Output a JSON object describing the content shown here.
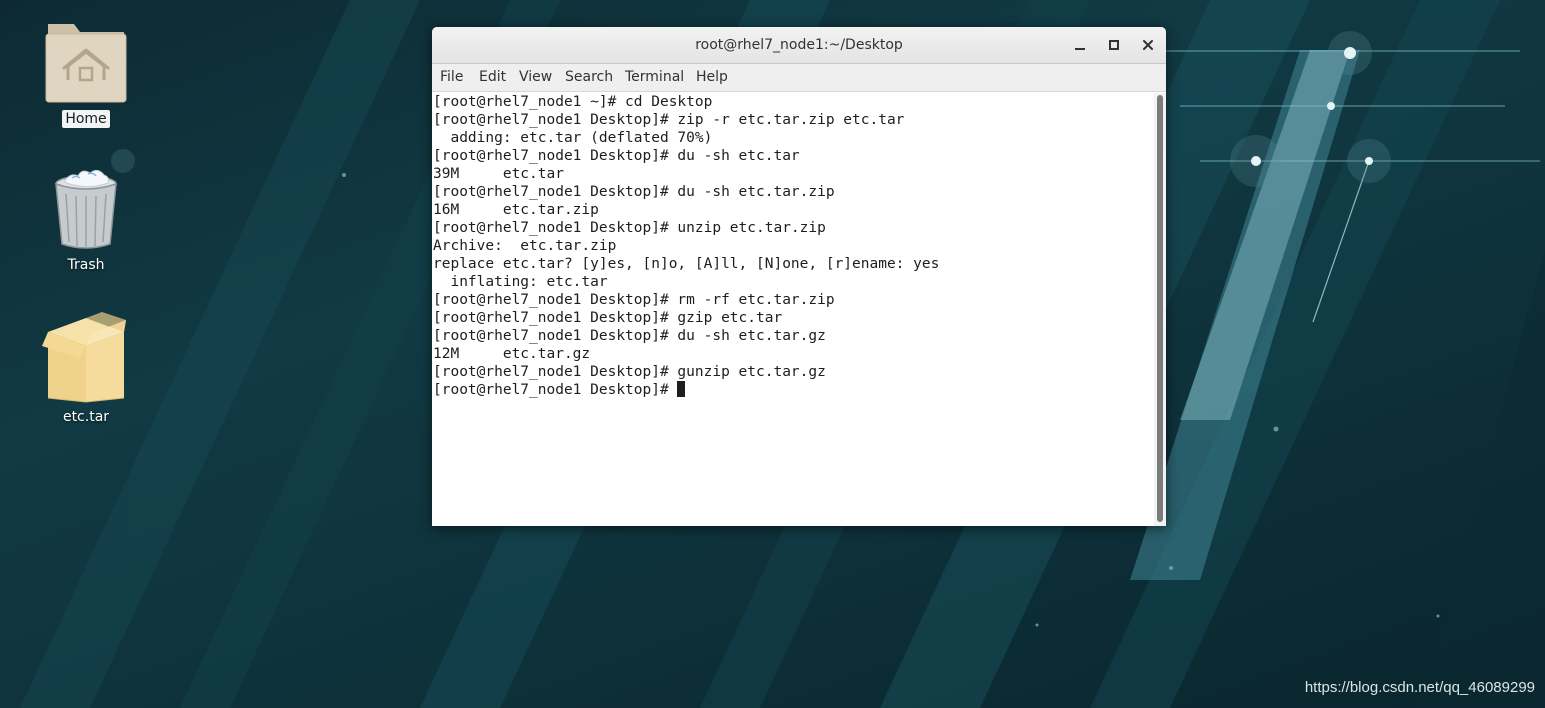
{
  "desktop": {
    "icons": [
      {
        "label": "Home",
        "icon": "home-folder-icon",
        "selected": true
      },
      {
        "label": "Trash",
        "icon": "trash-icon"
      },
      {
        "label": "etc.tar",
        "icon": "archive-package-icon"
      }
    ],
    "watermark": "https://blog.csdn.net/qq_46089299"
  },
  "terminal": {
    "title": "root@rhel7_node1:~/Desktop",
    "controls": {
      "minimize": "minimize-icon",
      "maximize": "maximize-icon",
      "close": "close-icon"
    },
    "menu": [
      "File",
      "Edit",
      "View",
      "Search",
      "Terminal",
      "Help"
    ],
    "lines": [
      "[root@rhel7_node1 ~]# cd Desktop",
      "[root@rhel7_node1 Desktop]# zip -r etc.tar.zip etc.tar",
      "  adding: etc.tar (deflated 70%)",
      "[root@rhel7_node1 Desktop]# du -sh etc.tar",
      "39M     etc.tar",
      "[root@rhel7_node1 Desktop]# du -sh etc.tar.zip",
      "16M     etc.tar.zip",
      "[root@rhel7_node1 Desktop]# unzip etc.tar.zip",
      "Archive:  etc.tar.zip",
      "replace etc.tar? [y]es, [n]o, [A]ll, [N]one, [r]ename: yes",
      "  inflating: etc.tar",
      "[root@rhel7_node1 Desktop]# rm -rf etc.tar.zip",
      "[root@rhel7_node1 Desktop]# gzip etc.tar",
      "[root@rhel7_node1 Desktop]# du -sh etc.tar.gz",
      "12M     etc.tar.gz",
      "[root@rhel7_node1 Desktop]# gunzip etc.tar.gz"
    ],
    "prompt": "[root@rhel7_node1 Desktop]# "
  }
}
